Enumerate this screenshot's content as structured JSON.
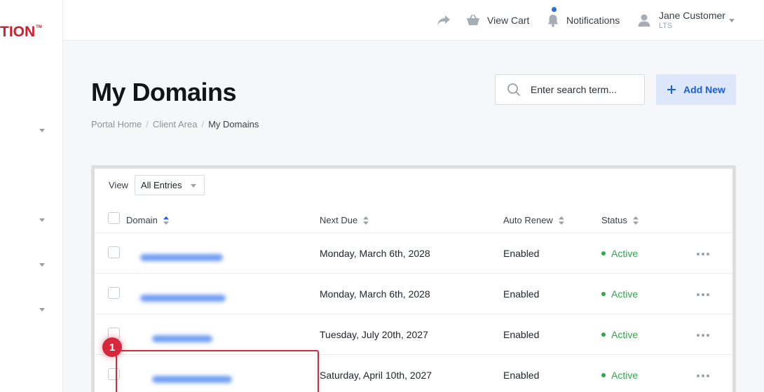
{
  "brand": {
    "logo_text": "TION",
    "tm": "TM",
    "color": "#cf1f2f"
  },
  "topbar": {
    "cart_label": "View Cart",
    "notifications_label": "Notifications",
    "user_name": "Jane Customer",
    "user_sub": "LTS"
  },
  "page": {
    "title": "My Domains",
    "breadcrumb": [
      "Portal Home",
      "Client Area",
      "My Domains"
    ]
  },
  "search": {
    "placeholder": "Enter search term..."
  },
  "add_button": {
    "label": "Add New"
  },
  "table": {
    "view_label": "View",
    "view_selected": "All Entries",
    "columns": [
      "Domain",
      "Next Due",
      "Auto Renew",
      "Status"
    ],
    "rows": [
      {
        "next_due": "Monday, March 6th, 2028",
        "auto_renew": "Enabled",
        "status": "Active"
      },
      {
        "next_due": "Monday, March 6th, 2028",
        "auto_renew": "Enabled",
        "status": "Active"
      },
      {
        "next_due": "Tuesday, July 20th, 2027",
        "auto_renew": "Enabled",
        "status": "Active"
      },
      {
        "next_due": "Saturday, April 10th, 2027",
        "auto_renew": "Enabled",
        "status": "Active"
      }
    ]
  },
  "annotation": {
    "number": "1",
    "color": "#d6283c"
  },
  "colors": {
    "accent": "#1a5fd6",
    "active": "#2ea84a",
    "button_bg": "#dde7fb"
  }
}
